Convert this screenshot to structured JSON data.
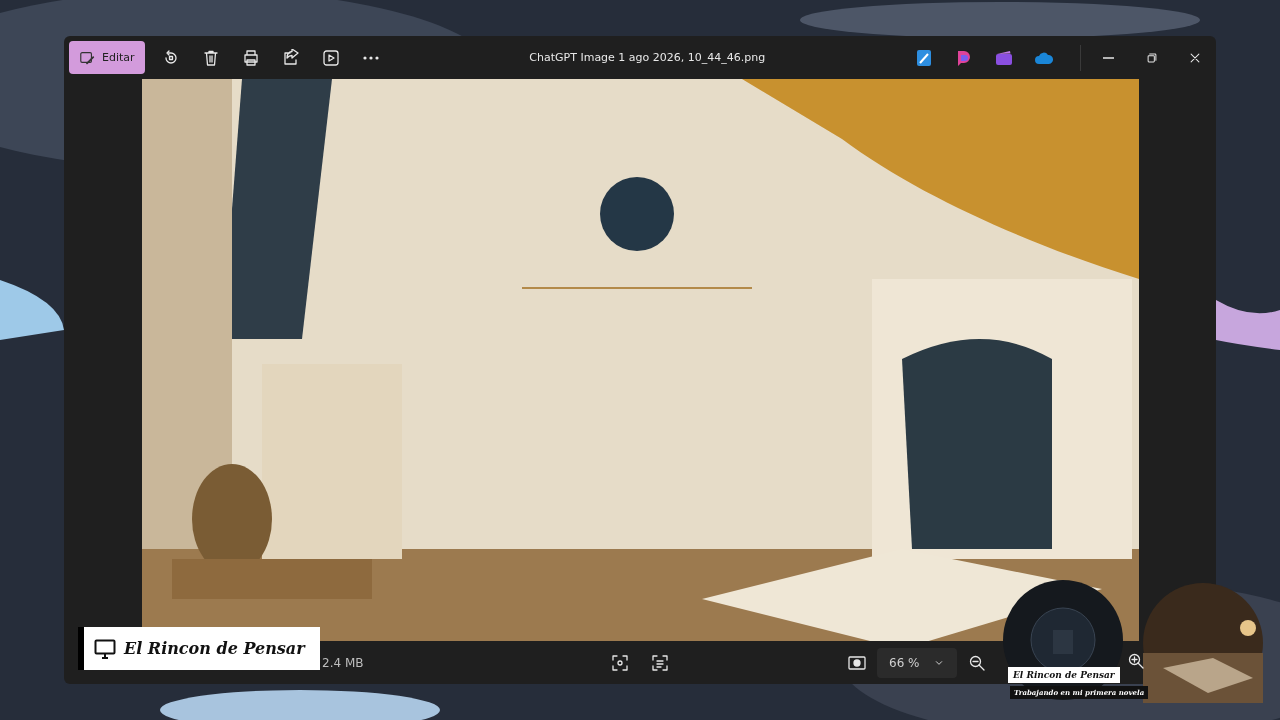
{
  "window": {
    "title": "ChatGPT Image 1 ago 2026, 10_44_46.png"
  },
  "toolbar": {
    "edit_button": "Editar"
  },
  "status_bar": {
    "file_size": "2.4 MB",
    "zoom": "66 %"
  },
  "overlays": {
    "channel_badge": "El Rincon de Pensar",
    "profile_title": "El Rincon de Pensar",
    "profile_subtitle": "Trabajando en mi primera novela"
  }
}
